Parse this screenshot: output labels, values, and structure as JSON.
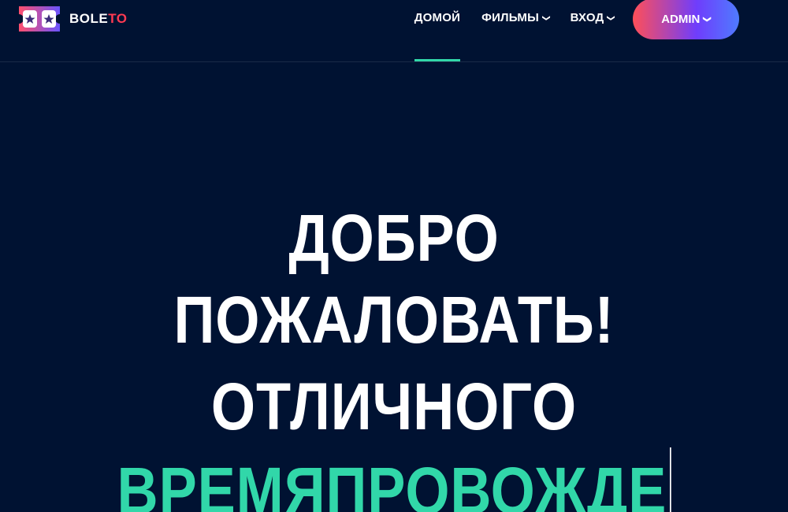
{
  "brand": {
    "name_main": "BOLE",
    "name_accent": "TO",
    "logo_icon": "ticket-icon",
    "accent_color": "#ff3a52"
  },
  "nav": {
    "items": [
      {
        "label": "ДОМОЙ",
        "active": true,
        "dropdown": false
      },
      {
        "label": "ФИЛЬМЫ",
        "active": false,
        "dropdown": true
      },
      {
        "label": "ВХОД",
        "active": false,
        "dropdown": true
      }
    ],
    "admin_label": "ADMIN",
    "active_indicator_color": "#31d7a9"
  },
  "hero": {
    "line1": "ДОБРО",
    "line2": "ПОЖАЛОВАТЬ!",
    "line3": "ОТЛИЧНОГО",
    "line4_typing": "ВРЕМЯПРОВОЖДЕ",
    "highlight_color": "#31d7a9"
  },
  "colors": {
    "background": "#001232",
    "text": "#ffffff"
  }
}
